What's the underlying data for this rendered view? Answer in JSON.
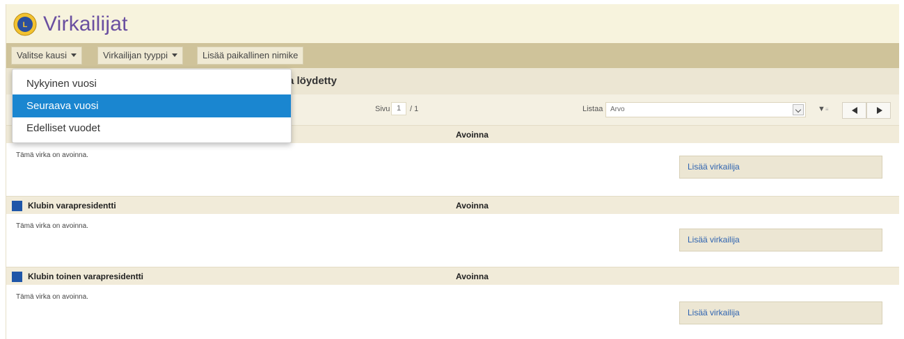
{
  "header": {
    "title": "Virkailijat"
  },
  "toolbar": {
    "season_label": "Valitse kausi",
    "officer_type_label": "Virkailijan tyyppi",
    "add_local_title_label": "Lisää paikallinen nimike"
  },
  "results": {
    "text": "a löydetty"
  },
  "pager": {
    "page_label": "Sivu",
    "page_value": "1",
    "page_total": "/ 1",
    "list_label": "Listaa",
    "list_value": "Arvo"
  },
  "season_menu": {
    "items": [
      {
        "label": "Nykyinen vuosi"
      },
      {
        "label": "Seuraava vuosi",
        "selected": true
      },
      {
        "label": "Edelliset vuodet"
      }
    ]
  },
  "sections": [
    {
      "title": "",
      "status": "Avoinna",
      "body": "Tämä virka on avoinna.",
      "button": "Lisää virkailija"
    },
    {
      "title": "Klubin varapresidentti",
      "status": "Avoinna",
      "body": "Tämä virka on avoinna.",
      "button": "Lisää virkailija"
    },
    {
      "title": "Klubin toinen varapresidentti",
      "status": "Avoinna",
      "body": "Tämä virka on avoinna.",
      "button": "Lisää virkailija"
    }
  ],
  "colors": {
    "title_purple": "#6a4fa0",
    "toolbar_bg": "#cfc39a",
    "menu_selected": "#1a86d0",
    "section_marker": "#1f56a8",
    "link_blue": "#2e63b0"
  }
}
